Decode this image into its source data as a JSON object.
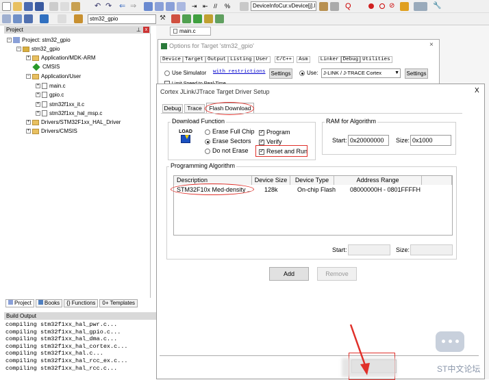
{
  "toolbar": {
    "find_combo": "DeviceInfoCur.vDevice[j].l",
    "target_combo": "stm32_gpio"
  },
  "project_panel": {
    "title": "Project",
    "tree": [
      "Project: stm32_gpio",
      "stm32_gpio",
      "Application/MDK-ARM",
      "CMSIS",
      "Application/User",
      "main.c",
      "gpio.c",
      "stm32f1xx_it.c",
      "stm32f1xx_hal_msp.c",
      "Drivers/STM32F1xx_HAL_Driver",
      "Drivers/CMSIS"
    ],
    "tabs": [
      "Project",
      "Books",
      "{} Functions",
      "0+ Templates"
    ]
  },
  "build_output": {
    "title": "Build Output",
    "lines": [
      "compiling stm32f1xx_hal_pwr.c...",
      "compiling stm32f1xx_hal_gpio.c...",
      "compiling stm32f1xx_hal_dma.c...",
      "compiling stm32f1xx_hal_cortex.c...",
      "compiling stm32f1xx_hal.c...",
      "compiling stm32f1xx_hal_rcc_ex.c...",
      "compiling stm32f1xx_hal_rcc.c..."
    ]
  },
  "editor": {
    "tab": "main.c"
  },
  "options_dialog": {
    "title": "Options for Target 'stm32_gpio'",
    "tabs": [
      "Device",
      "Target",
      "Output",
      "Listing",
      "User",
      "C/C++",
      "Asm",
      "Linker",
      "Debug",
      "Utilities"
    ],
    "use_simulator": "Use Simulator",
    "with_restrictions": "with restrictions",
    "settings": "Settings",
    "use": "Use:",
    "driver": "J-LINK / J-TRACE Cortex",
    "limit_speed": "Limit Speed to Real-Time"
  },
  "driver_dialog": {
    "title": "Cortex JLink/JTrace Target Driver Setup",
    "close": "X",
    "tabs": [
      "Debug",
      "Trace",
      "Flash Download"
    ],
    "download_function": {
      "label": "Download Function",
      "load_icon_text": "LOAD",
      "erase_full_chip": "Erase Full Chip",
      "erase_sectors": "Erase Sectors",
      "do_not_erase": "Do not Erase",
      "program": "Program",
      "verify": "Verify",
      "reset_and_run": "Reset and Run"
    },
    "ram": {
      "label": "RAM for Algorithm",
      "start_label": "Start:",
      "start": "0x20000000",
      "size_label": "Size:",
      "size": "0x1000"
    },
    "algorithm": {
      "label": "Programming Algorithm",
      "columns": [
        "Description",
        "Device Size",
        "Device Type",
        "Address Range"
      ],
      "rows": [
        {
          "description": "STM32F10x Med-density ...",
          "size": "128k",
          "type": "On-chip Flash",
          "range": "08000000H - 0801FFFFH"
        }
      ],
      "start_label": "Start:",
      "size_label": "Size:"
    },
    "add": "Add",
    "remove": "Remove"
  },
  "watermark": "ST中文论坛",
  "colors": {
    "annotation_red": "#e0302a",
    "selection_blue": "#3399ff"
  }
}
